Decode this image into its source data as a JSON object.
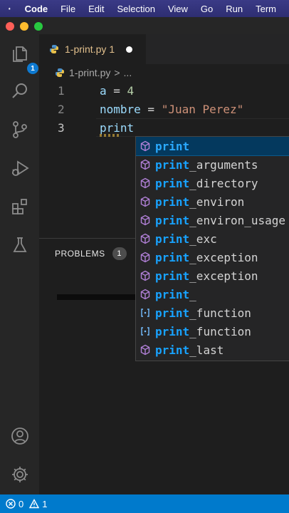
{
  "menubar": {
    "items": [
      "Code",
      "File",
      "Edit",
      "Selection",
      "View",
      "Go",
      "Run",
      "Term"
    ]
  },
  "activity": {
    "explorer_badge": "1",
    "icons": [
      "files-icon",
      "search-icon",
      "source-control-icon",
      "run-debug-icon",
      "extensions-icon",
      "testing-icon",
      "account-icon",
      "settings-gear-icon"
    ]
  },
  "tab": {
    "filename": "1-print.py",
    "problem_count": "1"
  },
  "breadcrumb": {
    "file": "1-print.py",
    "separator": ">",
    "more": "..."
  },
  "editor": {
    "lines": [
      {
        "number": "1",
        "var": "a",
        "op": " = ",
        "value": "4"
      },
      {
        "number": "2",
        "var": "nombre",
        "op": " = ",
        "value": "\"Juan Perez\""
      },
      {
        "number": "3",
        "var": "print",
        "op": "",
        "value": ""
      }
    ]
  },
  "panel": {
    "tab_label": "PROBLEMS",
    "count": "1"
  },
  "suggest": {
    "query": "print",
    "items": [
      {
        "match": "print",
        "rest": "",
        "kind": "cube-icon",
        "selected": true
      },
      {
        "match": "print",
        "rest": "_arguments",
        "kind": "cube-icon"
      },
      {
        "match": "print",
        "rest": "_directory",
        "kind": "cube-icon"
      },
      {
        "match": "print",
        "rest": "_environ",
        "kind": "cube-icon"
      },
      {
        "match": "print",
        "rest": "_environ_usage",
        "kind": "cube-icon"
      },
      {
        "match": "print",
        "rest": "_exc",
        "kind": "cube-icon"
      },
      {
        "match": "print",
        "rest": "_exception",
        "kind": "cube-icon"
      },
      {
        "match": "print",
        "rest": "_exception",
        "kind": "cube-icon"
      },
      {
        "match": "print",
        "rest": "_",
        "kind": "cube-icon"
      },
      {
        "match": "print",
        "rest": "_function",
        "kind": "brackets-icon"
      },
      {
        "match": "print",
        "rest": "_function",
        "kind": "brackets-icon"
      },
      {
        "match": "print",
        "rest": "_last",
        "kind": "cube-icon"
      }
    ]
  },
  "statusbar": {
    "errors": "0",
    "warnings": "1"
  },
  "colors": {
    "accent": "#007acc",
    "match": "#18a3ff",
    "selected_row": "#04395e"
  }
}
